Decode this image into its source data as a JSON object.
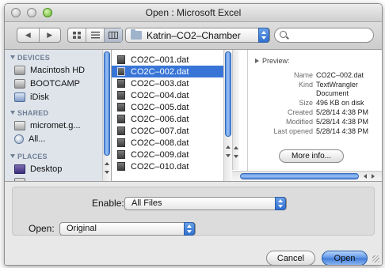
{
  "window": {
    "title": "Open : Microsoft Excel"
  },
  "toolbar": {
    "back_glyph": "◀",
    "forward_glyph": "▶",
    "view_icons": [
      "icon-view-icon",
      "list-view-icon",
      "column-view-icon"
    ],
    "path": "Katrin–CO2–Chamber",
    "search_placeholder": ""
  },
  "sidebar": {
    "sections": [
      {
        "title": "DEVICES",
        "items": [
          {
            "label": "Macintosh HD",
            "icon": "hard-drive-icon"
          },
          {
            "label": "BOOTCAMP",
            "icon": "hard-drive-icon"
          },
          {
            "label": "iDisk",
            "icon": "idisk-icon"
          }
        ]
      },
      {
        "title": "SHARED",
        "items": [
          {
            "label": "micromet.g...",
            "icon": "network-server-icon"
          },
          {
            "label": "All...",
            "icon": "network-globe-icon"
          }
        ]
      },
      {
        "title": "PLACES",
        "items": [
          {
            "label": "Desktop",
            "icon": "desktop-icon"
          }
        ]
      }
    ]
  },
  "files": {
    "selected_index": 1,
    "items": [
      "CO2C–001.dat",
      "CO2C–002.dat",
      "CO2C–003.dat",
      "CO2C–004.dat",
      "CO2C–005.dat",
      "CO2C–006.dat",
      "CO2C–007.dat",
      "CO2C–008.dat",
      "CO2C–009.dat",
      "CO2C–010.dat"
    ]
  },
  "preview": {
    "label": "Preview:",
    "fields": {
      "name_key": "Name",
      "name_val": "CO2C–002.dat",
      "kind_key": "Kind",
      "kind_val1": "TextWrangler",
      "kind_val2": "Document",
      "size_key": "Size",
      "size_val": "496 KB on disk",
      "created_key": "Created",
      "created_val": "5/28/14 4:38 PM",
      "modified_key": "Modified",
      "modified_val": "5/28/14 4:38 PM",
      "opened_key": "Last opened",
      "opened_val": "5/28/14 4:38 PM"
    },
    "more_info": "More info..."
  },
  "options": {
    "enable_label": "Enable:",
    "enable_value": "All Files",
    "open_label": "Open:",
    "open_value": "Original"
  },
  "buttons": {
    "cancel": "Cancel",
    "open": "Open"
  },
  "colors": {
    "selection": "#3875d7",
    "sidebar_bg": "#dfe4eb",
    "accent_button": "#5b93e5"
  }
}
